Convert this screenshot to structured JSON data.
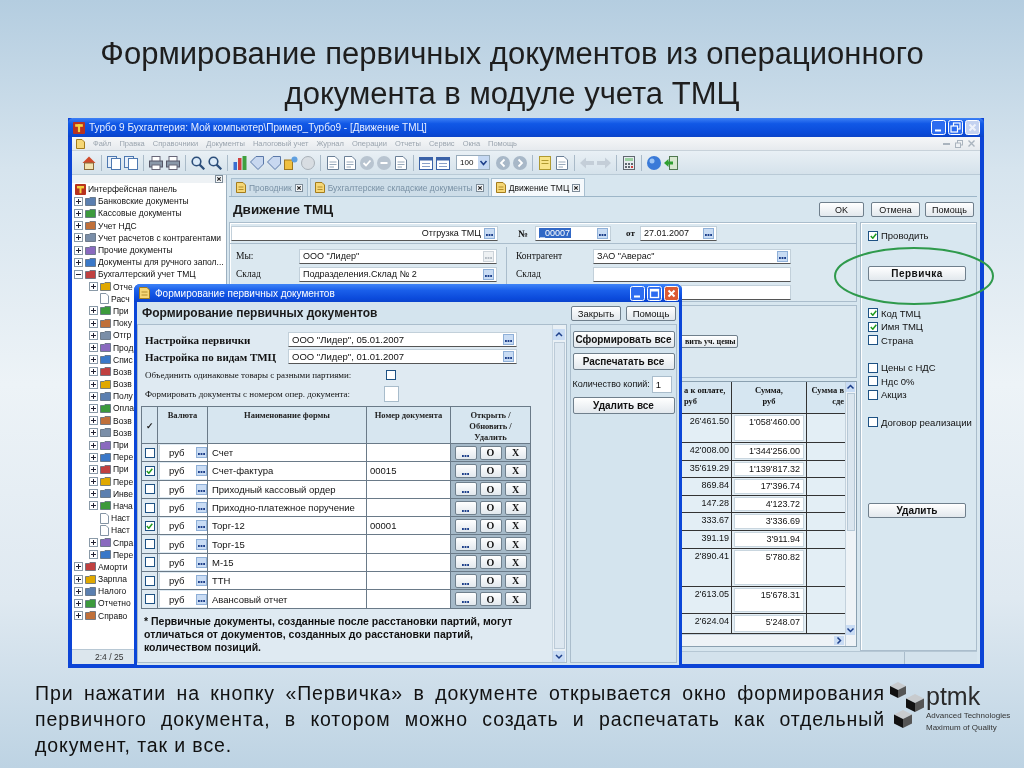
{
  "slide": {
    "title": "Формирование первичных документов из операционного документа в модуле учета ТМЦ",
    "caption": "При нажатии на кнопку «Первичка» в документе открывается окно формирования первичного документа, в котором можно создать и распечатать как отдельный документ, так и все.",
    "logo": {
      "name": "ptmk",
      "tagline": [
        "Advanced Technologies",
        "Maximum of Quality"
      ]
    }
  },
  "window": {
    "title": "Турбо 9 Бухгалтерия: Мой компьютер\\Пример_Турбо9 - [Движение ТМЦ]",
    "menu": [
      "Файл",
      "Правка",
      "Справочники",
      "Документы",
      "Налоговый учет",
      "Журнал",
      "Операции",
      "Отчеты",
      "Сервис",
      "Окна",
      "Помощь"
    ],
    "toolbar": {
      "zoom": "100"
    }
  },
  "navigator": {
    "tree": {
      "label": "Интерфейсная панель",
      "children": [
        {
          "label": "Банковские документы",
          "kind": "folder",
          "expanded": false
        },
        {
          "label": "Кассовые документы",
          "kind": "folder",
          "expanded": false
        },
        {
          "label": "Учет НДС",
          "kind": "folder",
          "expanded": false
        },
        {
          "label": "Учет расчетов с контрагентами",
          "kind": "folder",
          "expanded": false
        },
        {
          "label": "Прочие документы",
          "kind": "folder",
          "expanded": false
        },
        {
          "label": "Документы для ручного запол...",
          "kind": "folder",
          "expanded": false
        },
        {
          "label": "Бухгалтерский учет ТМЦ",
          "kind": "folder",
          "expanded": true,
          "children": [
            {
              "label": "Отче",
              "kind": "folder",
              "expanded": false
            },
            {
              "label": "Расч",
              "kind": "leaf"
            },
            {
              "label": "При",
              "kind": "folder",
              "expanded": false
            },
            {
              "label": "Поку",
              "kind": "folder",
              "expanded": false
            },
            {
              "label": "Отгр",
              "kind": "folder",
              "expanded": false
            },
            {
              "label": "Прод",
              "kind": "folder",
              "expanded": false
            },
            {
              "label": "Спис",
              "kind": "folder",
              "expanded": false
            },
            {
              "label": "Возв",
              "kind": "folder",
              "expanded": false
            },
            {
              "label": "Возв",
              "kind": "folder",
              "expanded": false
            },
            {
              "label": "Полу",
              "kind": "folder",
              "expanded": false
            },
            {
              "label": "Опла",
              "kind": "folder",
              "expanded": false
            },
            {
              "label": "Возв",
              "kind": "folder",
              "expanded": false
            },
            {
              "label": "Возв",
              "kind": "folder",
              "expanded": false
            },
            {
              "label": "При",
              "kind": "folder",
              "expanded": false
            },
            {
              "label": "Пере",
              "kind": "folder",
              "expanded": false
            },
            {
              "label": "При",
              "kind": "folder",
              "expanded": false
            },
            {
              "label": "Пере",
              "kind": "folder",
              "expanded": false
            },
            {
              "label": "Инве",
              "kind": "folder",
              "expanded": false
            },
            {
              "label": "Нача",
              "kind": "folder",
              "expanded": false
            },
            {
              "label": "Наст",
              "kind": "leaf"
            },
            {
              "label": "Наст",
              "kind": "leaf"
            },
            {
              "label": "Спра",
              "kind": "folder",
              "expanded": false
            },
            {
              "label": "Пере",
              "kind": "folder",
              "expanded": false
            }
          ]
        },
        {
          "label": "Аморти",
          "kind": "folder",
          "expanded": false
        },
        {
          "label": "Зарпла",
          "kind": "folder",
          "expanded": false
        },
        {
          "label": "Налого",
          "kind": "folder",
          "expanded": false
        },
        {
          "label": "Отчетно",
          "kind": "folder",
          "expanded": false
        },
        {
          "label": "Справо",
          "kind": "folder",
          "expanded": false
        }
      ]
    },
    "status": "2:4 / 25"
  },
  "tabs": [
    {
      "label": "Проводник",
      "selected": false
    },
    {
      "label": "Бухгалтерские складские документы",
      "selected": false
    },
    {
      "label": "Движение ТМЦ",
      "selected": true
    }
  ],
  "document": {
    "title": "Движение ТМЦ",
    "buttons": [
      "OK",
      "Отмена",
      "Помощь"
    ],
    "operation": "Отгрузка ТМЦ",
    "number_label": "№",
    "number": {
      "value": "_00007",
      "focused": true
    },
    "date_label": "от",
    "date": "27.01.2007",
    "left_fields": [
      {
        "label": "Мы:",
        "value": "ООО \"Лидер\"",
        "disabled": true
      },
      {
        "label": "Склад",
        "value": "Подразделения.Склад № 2",
        "disabled": false
      }
    ],
    "right_fields": [
      {
        "label": "Контрагент",
        "value": "ЗАО \"Аверас\"",
        "kind": "lookup"
      },
      {
        "label": "Склад",
        "kind": "text"
      },
      {
        "kind": "text"
      }
    ],
    "price_button": "вить уч. цены",
    "table": {
      "columns": [
        "а к оплате,\nруб",
        "Сумма,\nруб",
        "Сумма в\nсде"
      ],
      "rows": [
        [
          "26'461.50",
          "1'058'460.00"
        ],
        [
          "42'008.00",
          "1'344'256.00"
        ],
        [
          "35'619.29",
          "1'139'817.32"
        ],
        [
          "869.84",
          "17'396.74"
        ],
        [
          "147.28",
          "4'123.72"
        ],
        [
          "333.67",
          "3'336.69"
        ],
        [
          "391.19",
          "3'911.94"
        ],
        [
          "2'890.41",
          "5'780.82"
        ],
        [
          "2'613.05",
          "15'678.31"
        ],
        [
          "2'624.04",
          "5'248.07"
        ]
      ]
    },
    "side": {
      "post": {
        "label": "Проводить",
        "checked": true
      },
      "primary_button": "Первичка",
      "options": [
        [
          {
            "label": "Код ТМЦ",
            "checked": true
          },
          {
            "label": "Имя ТМЦ",
            "checked": true
          },
          {
            "label": "Страна",
            "checked": false
          }
        ],
        [
          {
            "label": "Цены с НДС",
            "checked": false
          },
          {
            "label": "Ндс 0%",
            "checked": false
          },
          {
            "label": "Акциз",
            "checked": false
          }
        ],
        [
          {
            "label": "Договор реализации",
            "checked": false
          }
        ]
      ],
      "delete_button": "Удалить"
    }
  },
  "dialog": {
    "title": "Формирование первичных документов",
    "heading": "Формирование первичных документов",
    "buttons": [
      "Закрыть",
      "Помощь"
    ],
    "settings": [
      {
        "label": "Настройка первички",
        "value": "ООО \"Лидер\", 05.01.2007"
      },
      {
        "label": "Настройка по видам ТМЦ",
        "value": "ООО \"Лидер\", 01.01.2007"
      }
    ],
    "options": [
      {
        "label": "Объединить одинаковые товары с разными партиями:",
        "kind": "checkbox",
        "checked": false
      },
      {
        "label": "Формировать документы с номером опер. документа:",
        "kind": "field"
      }
    ],
    "table": {
      "columns": [
        "✓",
        "Валюта",
        "Наименование формы",
        "Номер документа",
        "Открыть /\nОбновить /\nУдалить"
      ],
      "rows": [
        {
          "checked": false,
          "currency": "руб",
          "form": "Счет",
          "actions": [
            "О",
            "X"
          ]
        },
        {
          "checked": true,
          "currency": "руб",
          "form": "Счет-фактура",
          "number": "00015",
          "actions": [
            "О",
            "X"
          ]
        },
        {
          "checked": false,
          "currency": "руб",
          "form": "Приходный кассовый ордер",
          "actions": [
            "О",
            "X"
          ]
        },
        {
          "checked": false,
          "currency": "руб",
          "form": "Приходно-платежное поручение",
          "actions": [
            "О",
            "X"
          ]
        },
        {
          "checked": true,
          "currency": "руб",
          "form": "Торг-12",
          "number": "00001",
          "actions": [
            "О",
            "X"
          ]
        },
        {
          "checked": false,
          "currency": "руб",
          "form": "Торг-15",
          "actions": [
            "О",
            "X"
          ]
        },
        {
          "checked": false,
          "currency": "руб",
          "form": "М-15",
          "actions": [
            "О",
            "X"
          ]
        },
        {
          "checked": false,
          "currency": "руб",
          "form": "ТТН",
          "actions": [
            "О",
            "X"
          ]
        },
        {
          "checked": false,
          "currency": "руб",
          "form": "Авансовый отчет",
          "actions": [
            "О",
            "X"
          ]
        }
      ]
    },
    "note": "* Первичные документы, созданные после расстановки партий, могут\nотличаться от документов, созданных до расстановки партий,\nколичеством позиций.",
    "actions": {
      "generate": "Сформировать все",
      "print": "Распечатать все",
      "copies_label": "Количество копий:",
      "copies": "1",
      "delete": "Удалить все"
    }
  }
}
